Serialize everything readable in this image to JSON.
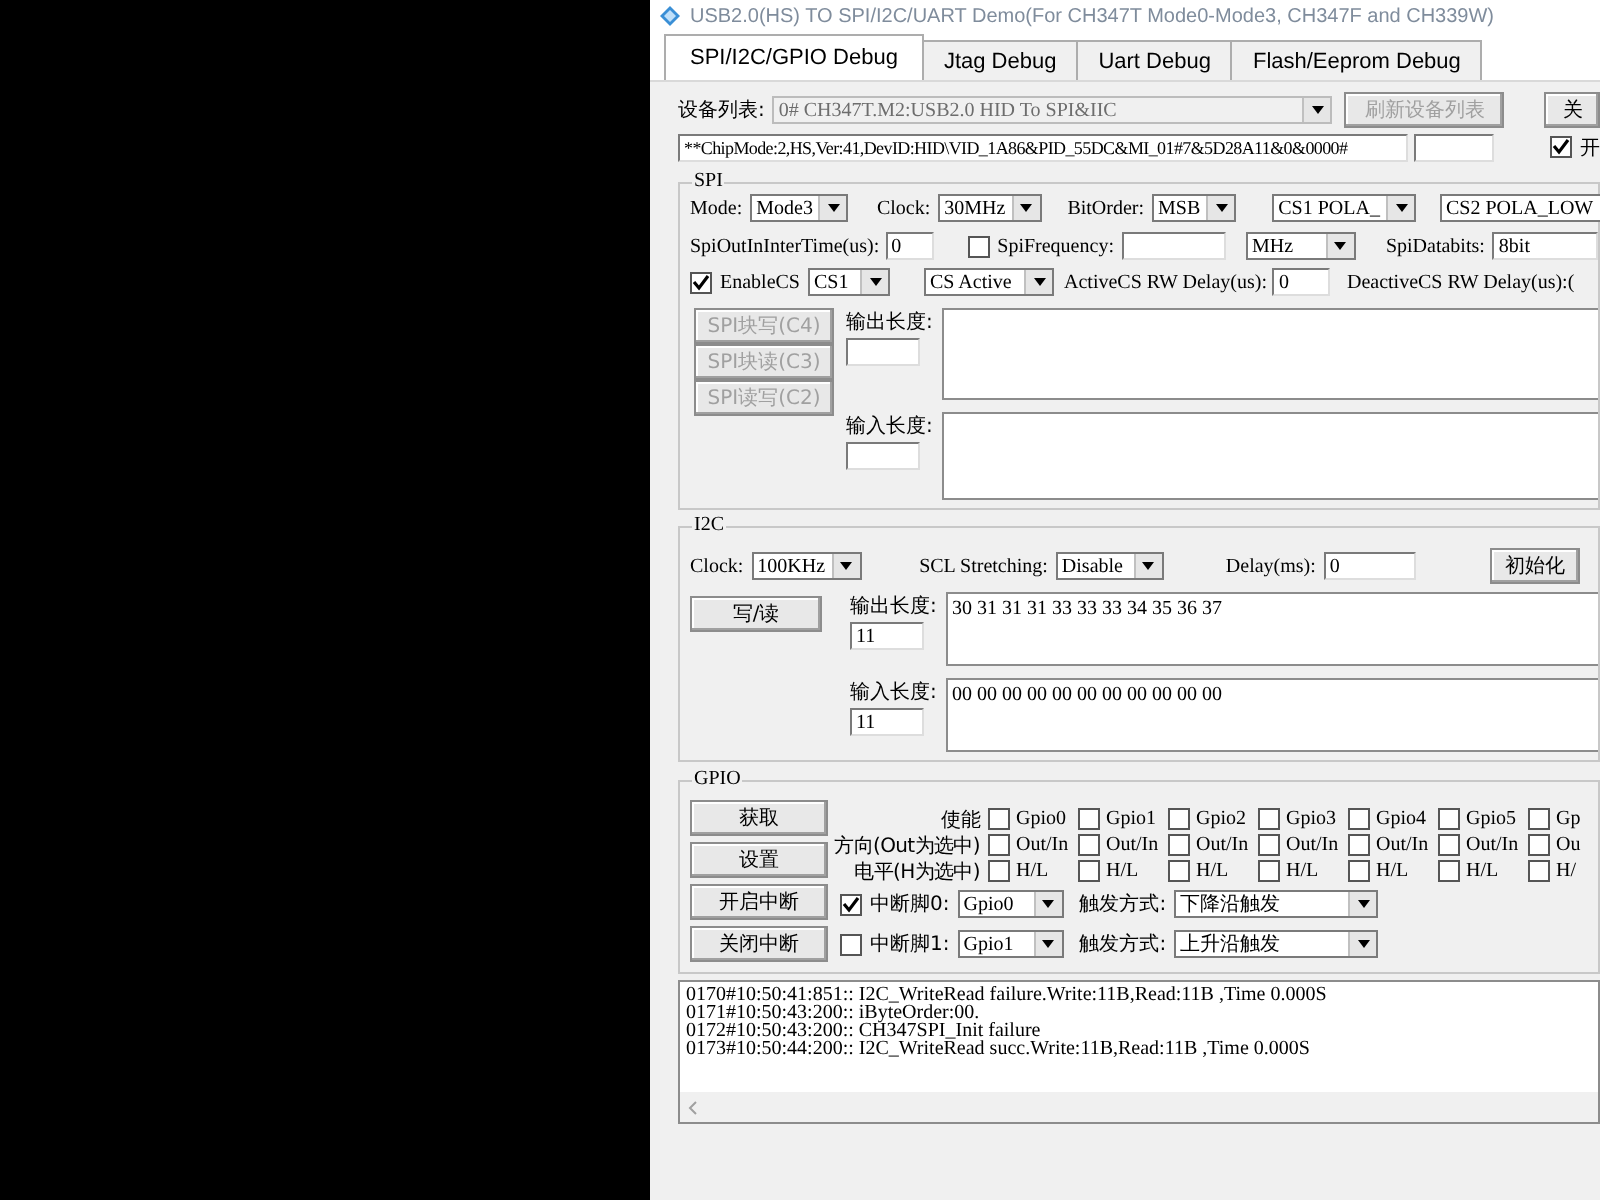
{
  "window": {
    "title": "USB2.0(HS) TO SPI/I2C/UART Demo(For CH347T Mode0-Mode3, CH347F and CH339W)"
  },
  "tabs": [
    {
      "label": "SPI/I2C/GPIO Debug",
      "selected": true
    },
    {
      "label": "Jtag Debug",
      "selected": false
    },
    {
      "label": "Uart Debug",
      "selected": false
    },
    {
      "label": "Flash/Eeprom Debug",
      "selected": false
    }
  ],
  "device": {
    "label": "设备列表:",
    "list": {
      "value": "0# CH347T.M2:USB2.0 HID To SPI&IIC",
      "disabled": true
    },
    "refresh_button": {
      "label": "刷新设备列表",
      "disabled": true
    },
    "close_button": {
      "label": "关",
      "disabled": false
    },
    "info": "**ChipMode:2,HS,Ver:41,DevID:HID\\VID_1A86&PID_55DC&MI_01#7&5D28A11&0&0000#",
    "open_checkbox": {
      "label": "开",
      "checked": true
    }
  },
  "spi": {
    "title": "SPI",
    "settings_rows": [
      {
        "items": [
          {
            "kind": "label",
            "text": "Mode:"
          },
          {
            "kind": "combo",
            "value": "Mode3"
          },
          {
            "kind": "label",
            "text": "Clock:"
          },
          {
            "kind": "combo",
            "value": "30MHz"
          },
          {
            "kind": "label",
            "text": "BitOrder:"
          },
          {
            "kind": "combo",
            "value": "MSB"
          },
          {
            "kind": "combo",
            "value": "CS1 POLA_"
          },
          {
            "kind": "combo",
            "value": "CS2 POLA_LOW"
          }
        ]
      },
      {
        "items": [
          {
            "kind": "label",
            "text": "SpiOutInInterTime(us):"
          },
          {
            "kind": "field",
            "value": "0"
          },
          {
            "kind": "checkbox",
            "label": "SpiFrequency:",
            "checked": false
          },
          {
            "kind": "field"
          },
          {
            "kind": "combo",
            "value": "MHz"
          },
          {
            "kind": "label",
            "text": "SpiDatabits:"
          },
          {
            "kind": "field",
            "value": "8bit"
          }
        ]
      },
      {
        "items": [
          {
            "kind": "checkbox",
            "label": "EnableCS",
            "checked": true
          },
          {
            "kind": "combo",
            "value": "CS1"
          },
          {
            "kind": "combo",
            "value": "CS Active"
          },
          {
            "kind": "label",
            "text": "ActiveCS RW Delay(us):"
          },
          {
            "kind": "field",
            "value": "0"
          },
          {
            "kind": "label",
            "text": "DeactiveCS RW Delay(us):("
          }
        ]
      }
    ],
    "buttons": [
      {
        "label": "SPI块写(C4)",
        "disabled": true
      },
      {
        "label": "SPI块读(C3)",
        "disabled": true
      },
      {
        "label": "SPI读写(C2)",
        "disabled": true
      }
    ],
    "output": {
      "label": "输出长度:"
    },
    "input": {
      "label": "输入长度:"
    }
  },
  "i2c": {
    "title": "I2C",
    "settings": [
      {
        "kind": "label",
        "text": "Clock:"
      },
      {
        "kind": "combo",
        "value": "100KHz"
      },
      {
        "kind": "label",
        "text": "SCL Stretching:"
      },
      {
        "kind": "combo",
        "value": "Disable"
      },
      {
        "kind": "label",
        "text": "Delay(ms):"
      },
      {
        "kind": "field",
        "value": "0"
      },
      {
        "kind": "button",
        "label": "初始化",
        "disabled": false
      }
    ],
    "write_read_button": "写/读",
    "output": {
      "label": "输出长度:",
      "length": "11",
      "data": "30 31 31 31 33 33 33 34 35 36 37"
    },
    "input": {
      "label": "输入长度:",
      "length": "11",
      "data": "00 00 00 00 00 00 00 00 00 00 00"
    }
  },
  "gpio": {
    "title": "GPIO",
    "buttons": [
      "获取",
      "设置",
      "开启中断",
      "关闭中断"
    ],
    "rows": [
      {
        "label": "使能",
        "items": [
          {
            "label": "Gpio0",
            "checked": false
          },
          {
            "label": "Gpio1",
            "checked": false
          },
          {
            "label": "Gpio2",
            "checked": false
          },
          {
            "label": "Gpio3",
            "checked": false
          },
          {
            "label": "Gpio4",
            "checked": false
          },
          {
            "label": "Gpio5",
            "checked": false
          },
          {
            "label": "Gp",
            "checked": false
          }
        ]
      },
      {
        "label": "方向(Out为选中)",
        "items": [
          {
            "label": "Out/In",
            "checked": false
          },
          {
            "label": "Out/In",
            "checked": false
          },
          {
            "label": "Out/In",
            "checked": false
          },
          {
            "label": "Out/In",
            "checked": false
          },
          {
            "label": "Out/In",
            "checked": false
          },
          {
            "label": "Out/In",
            "checked": false
          },
          {
            "label": "Ou",
            "checked": false
          }
        ]
      },
      {
        "label": "电平(H为选中)",
        "items": [
          {
            "label": "H/L",
            "checked": false
          },
          {
            "label": "H/L",
            "checked": false
          },
          {
            "label": "H/L",
            "checked": false
          },
          {
            "label": "H/L",
            "checked": false
          },
          {
            "label": "H/L",
            "checked": false
          },
          {
            "label": "H/L",
            "checked": false
          },
          {
            "label": "H/",
            "checked": false
          }
        ]
      }
    ],
    "interrupts": [
      {
        "checked": true,
        "label": "中断脚0:",
        "pin": "Gpio0",
        "trigger_label": "触发方式:",
        "trigger": "下降沿触发"
      },
      {
        "checked": false,
        "label": "中断脚1:",
        "pin": "Gpio1",
        "trigger_label": "触发方式:",
        "trigger": "上升沿触发"
      }
    ]
  },
  "log": {
    "lines": [
      "0170#10:50:41:851:: I2C_WriteRead failure.Write:11B,Read:11B ,Time 0.000S",
      "0171#10:50:43:200:: iByteOrder:00.",
      "0172#10:50:43:200:: CH347SPI_Init failure",
      "0173#10:50:44:200:: I2C_WriteRead succ.Write:11B,Read:11B ,Time 0.000S"
    ]
  }
}
